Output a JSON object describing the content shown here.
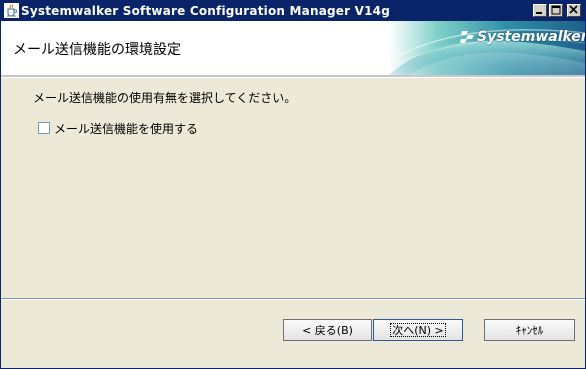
{
  "window": {
    "title": "Systemwalker Software Configuration Manager V14g",
    "colors": {
      "titlebar": "#0a246a",
      "background": "#ece9d8",
      "accent": "#2c5a94"
    }
  },
  "header": {
    "title": "メール送信機能の環境設定",
    "brand": "Systemwalker"
  },
  "content": {
    "instruction": "メール送信機能の使用有無を選択してください。",
    "checkbox": {
      "label": "メール送信機能を使用する",
      "checked": false
    }
  },
  "buttons": {
    "back": "< 戻る(B)",
    "next": "次へ(N) >",
    "cancel": "ｷｬﾝｾﾙ"
  },
  "icons": {
    "app": "java-cup-icon",
    "minimize": "minimize-icon",
    "maximize": "maximize-icon",
    "close": "close-icon",
    "brand_logo": "systemwalker-logo-icon"
  }
}
